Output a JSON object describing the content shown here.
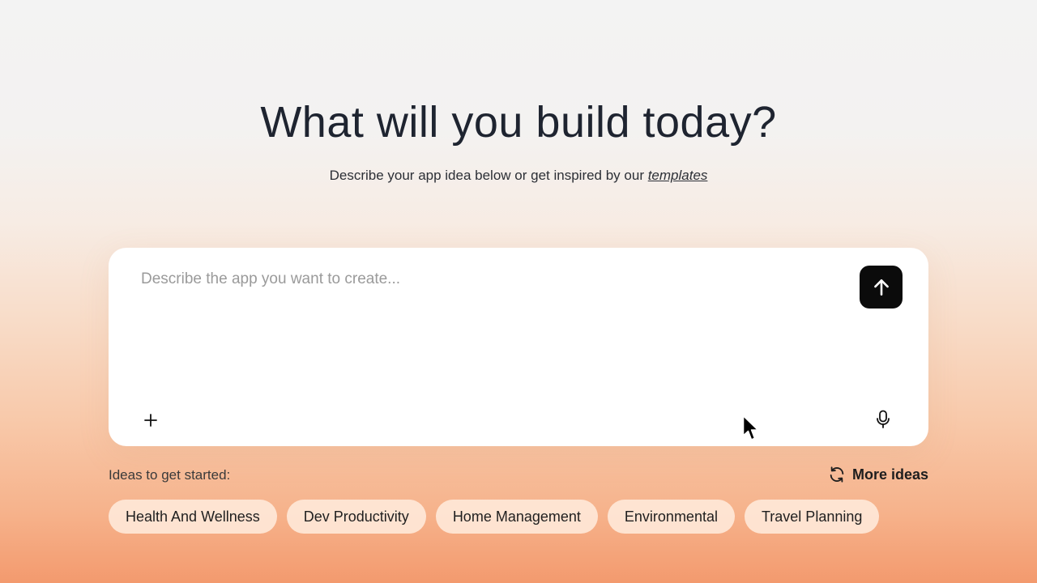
{
  "hero": {
    "title": "What will you build today?",
    "subtitle_prefix": "Describe your app idea below or get inspired by our ",
    "subtitle_link": "templates"
  },
  "prompt": {
    "placeholder": "Describe the app you want to create...",
    "value": ""
  },
  "icons": {
    "send": "arrow-up-icon",
    "attach": "plus-icon",
    "mic": "microphone-icon",
    "refresh": "refresh-icon"
  },
  "ideas": {
    "label": "Ideas to get started:",
    "more_label": "More ideas",
    "chips": [
      "Health And Wellness",
      "Dev Productivity",
      "Home Management",
      "Environmental",
      "Travel Planning"
    ]
  },
  "colors": {
    "send_button": "#0b0b0b",
    "background_top": "#f3f3f3",
    "background_bottom": "#f39a6e"
  }
}
